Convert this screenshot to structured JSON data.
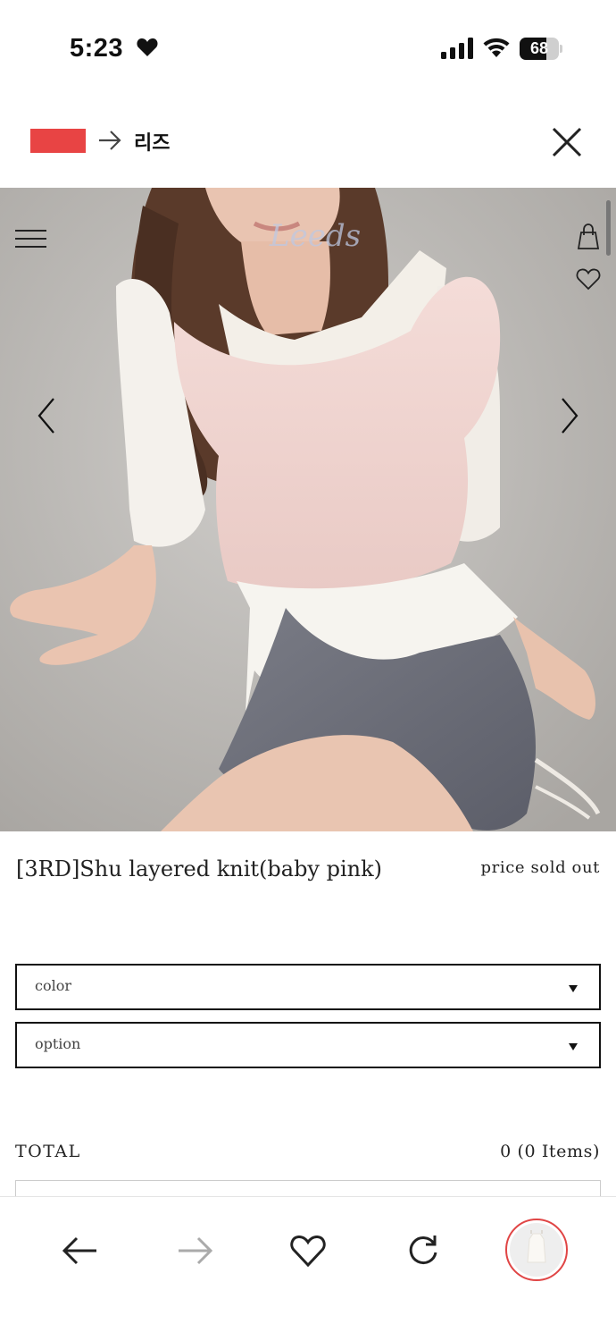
{
  "status_bar": {
    "time": "5:23",
    "battery_level": 68,
    "battery_text": "68"
  },
  "redirect": {
    "source_color": "#e84444",
    "destination": "리즈"
  },
  "gallery": {
    "watermark": "Leeds"
  },
  "product": {
    "title": "[3RD]Shu layered knit(baby pink)",
    "price_status": "price sold out"
  },
  "options": {
    "color_label": "color",
    "option_label": "option"
  },
  "total": {
    "label": "TOTAL",
    "value": "0 (0 Items)"
  },
  "colors": {
    "accent": "#e04545",
    "text": "#111111"
  }
}
